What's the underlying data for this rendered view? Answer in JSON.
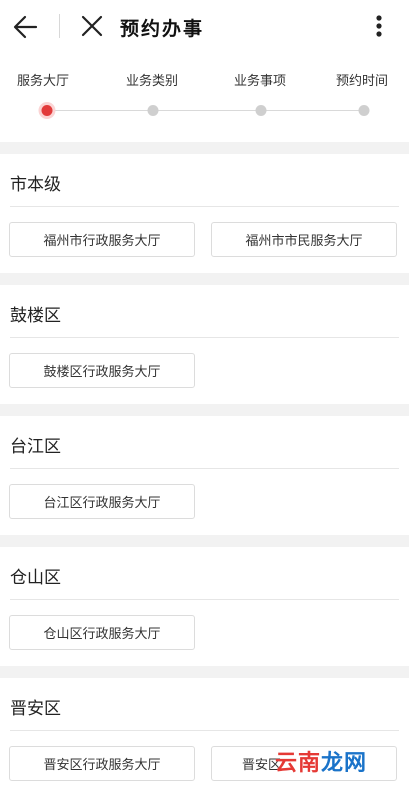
{
  "header": {
    "title": "预约办事",
    "back_icon": "arrow-left-icon",
    "close_icon": "close-icon",
    "more_icon": "more-vertical-icon"
  },
  "steps": [
    {
      "label": "服务大厅",
      "active": true
    },
    {
      "label": "业务类别",
      "active": false
    },
    {
      "label": "业务事项",
      "active": false
    },
    {
      "label": "预约时间",
      "active": false
    }
  ],
  "colors": {
    "active_step": "#e23b3b",
    "inactive_step": "#cfcfcf",
    "page_bg": "#f2f2f2"
  },
  "sections": [
    {
      "title": "市本级",
      "halls": [
        "福州市行政服务大厅",
        "福州市市民服务大厅"
      ]
    },
    {
      "title": "鼓楼区",
      "halls": [
        "鼓楼区行政服务大厅"
      ]
    },
    {
      "title": "台江区",
      "halls": [
        "台江区行政服务大厅"
      ]
    },
    {
      "title": "仓山区",
      "halls": [
        "仓山区行政服务大厅"
      ]
    },
    {
      "title": "晋安区",
      "halls": [
        "晋安区行政服务大厅",
        "晋安区"
      ]
    }
  ],
  "watermark": {
    "part1": "云南",
    "part2": "龙网"
  }
}
